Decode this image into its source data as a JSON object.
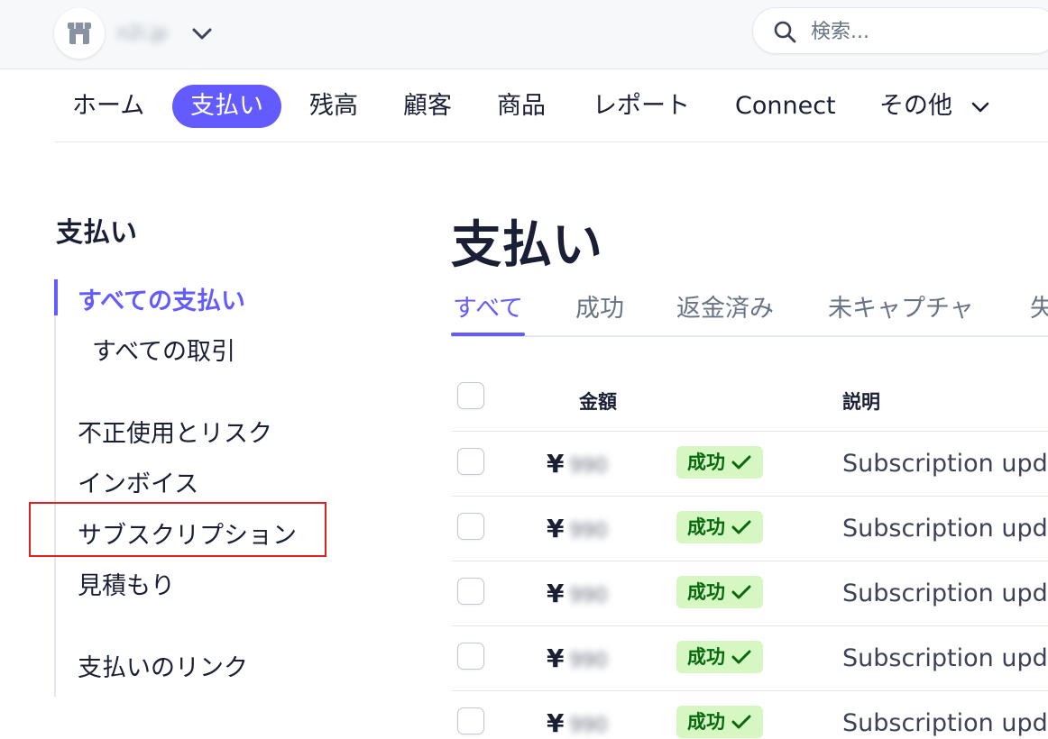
{
  "top_bar": {
    "account_name": "n2i.jp",
    "search": {
      "placeholder": "検索...",
      "value": ""
    }
  },
  "main_nav": {
    "items": [
      {
        "label": "ホーム",
        "active": false
      },
      {
        "label": "支払い",
        "active": true
      },
      {
        "label": "残高",
        "active": false
      },
      {
        "label": "顧客",
        "active": false
      },
      {
        "label": "商品",
        "active": false
      },
      {
        "label": "レポート",
        "active": false
      },
      {
        "label": "Connect",
        "active": false
      },
      {
        "label": "その他",
        "active": false
      }
    ]
  },
  "sidebar": {
    "title": "支払い",
    "items": [
      {
        "label": "すべての支払い",
        "active": true
      },
      {
        "label": "すべての取引",
        "active": false
      },
      {
        "label": "不正使用とリスク",
        "active": false
      },
      {
        "label": "インボイス",
        "active": false
      },
      {
        "label": "サブスクリプション",
        "active": false,
        "highlighted": true
      },
      {
        "label": "見積もり",
        "active": false
      },
      {
        "label": "支払いのリンク",
        "active": false
      }
    ]
  },
  "main": {
    "title": "支払い",
    "tabs": [
      {
        "label": "すべて",
        "active": true
      },
      {
        "label": "成功",
        "active": false
      },
      {
        "label": "返金済み",
        "active": false
      },
      {
        "label": "未キャプチャ",
        "active": false
      },
      {
        "label": "失",
        "active": false
      }
    ],
    "table": {
      "columns": [
        "金額",
        "説明"
      ],
      "rows": [
        {
          "currency": "¥",
          "amount": "990",
          "status": "成功",
          "description": "Subscription upda"
        },
        {
          "currency": "¥",
          "amount": "990",
          "status": "成功",
          "description": "Subscription upda"
        },
        {
          "currency": "¥",
          "amount": "990",
          "status": "成功",
          "description": "Subscription upda"
        },
        {
          "currency": "¥",
          "amount": "990",
          "status": "成功",
          "description": "Subscription upda"
        },
        {
          "currency": "¥",
          "amount": "990",
          "status": "成功",
          "description": "Subscription upda"
        }
      ]
    }
  },
  "colors": {
    "accent": "#635bff",
    "success_bg": "#d7f7c2",
    "success_text": "#05690d",
    "highlight_border": "#e0201f"
  },
  "icons": {
    "account": "store-icon",
    "account_menu": "chevron-down-icon",
    "search": "search-icon",
    "more": "chevron-down-icon",
    "status": "check-icon"
  }
}
